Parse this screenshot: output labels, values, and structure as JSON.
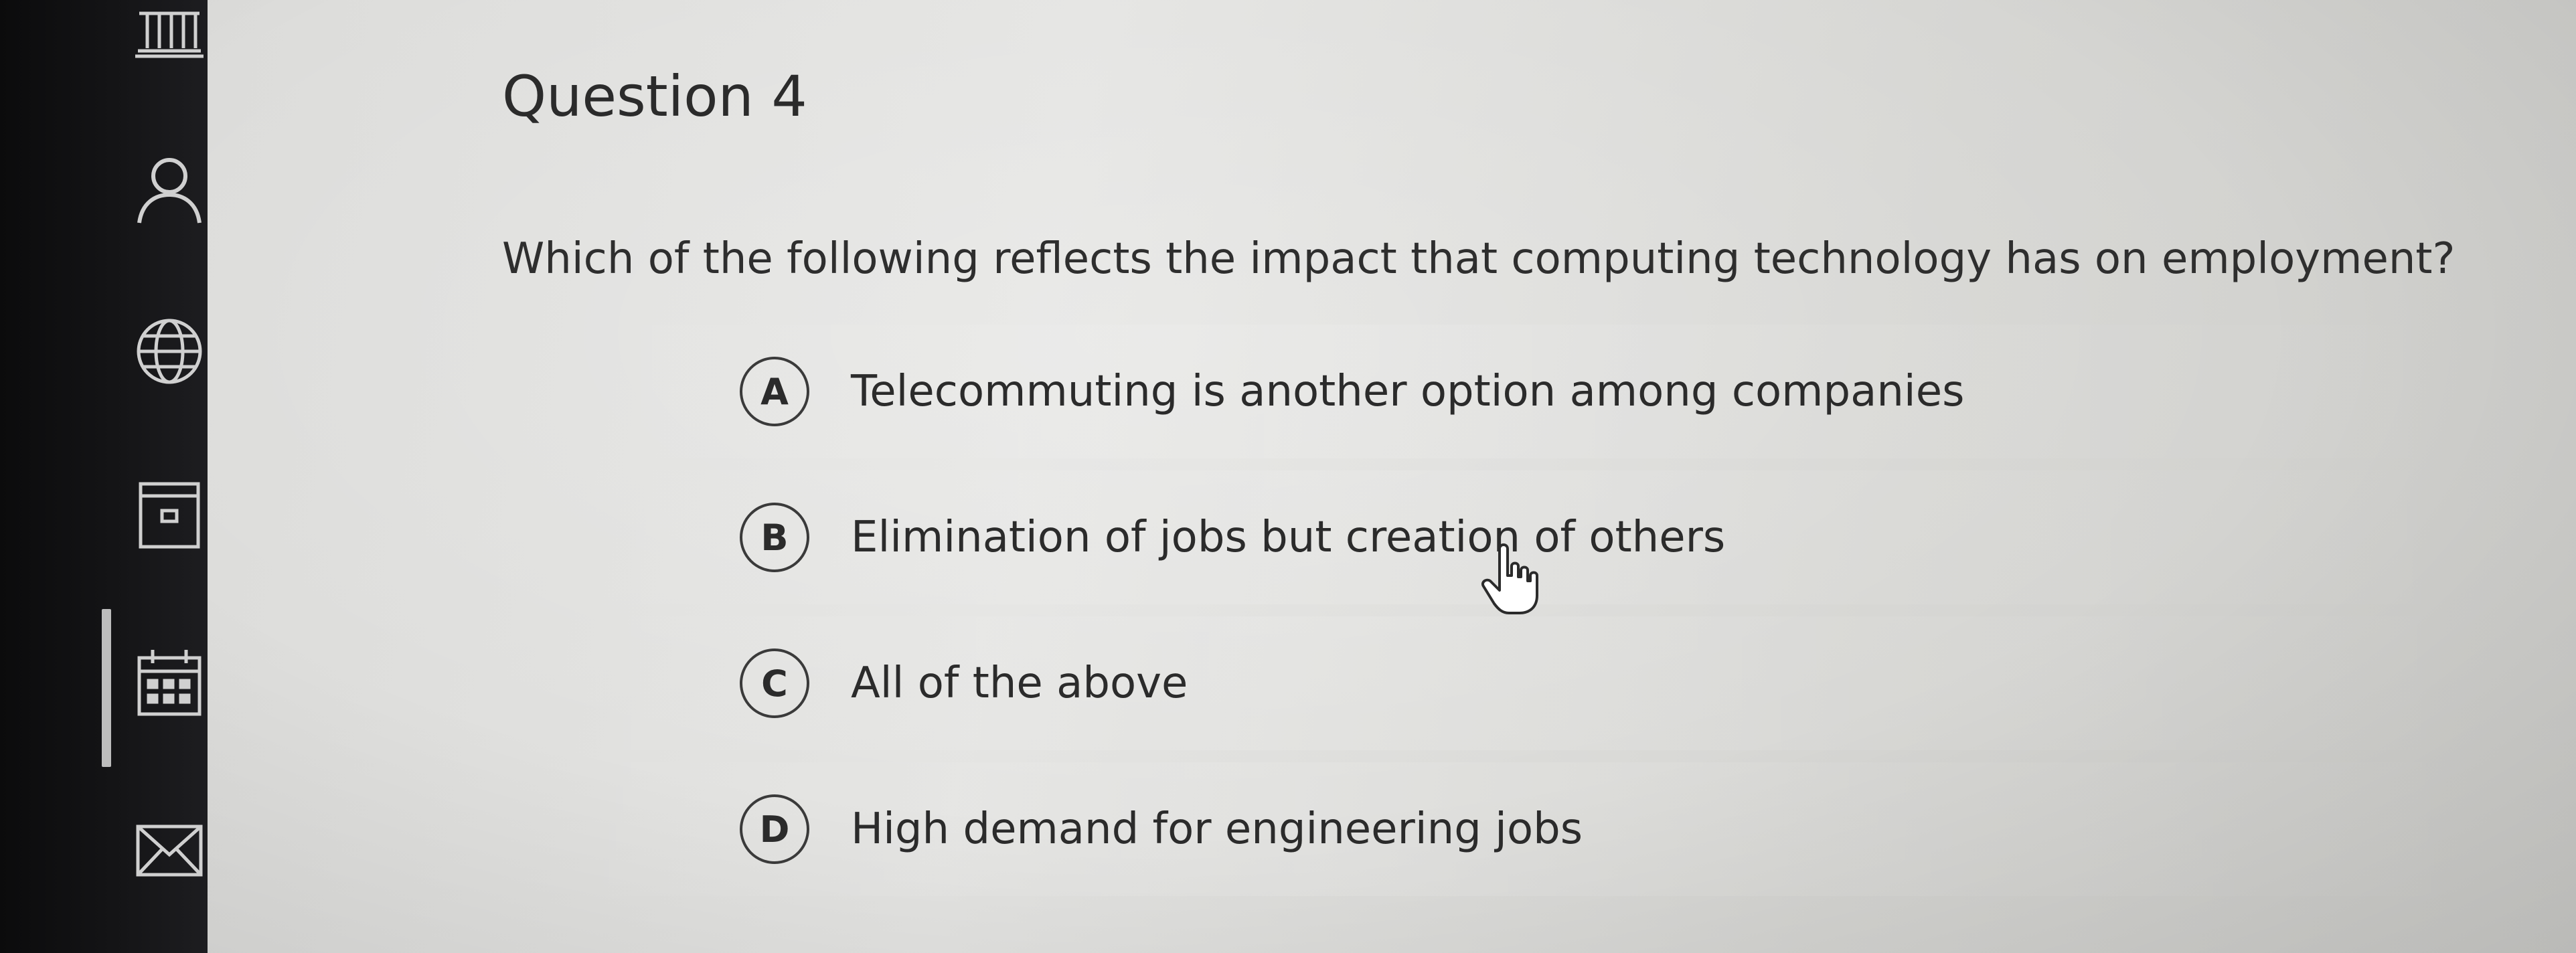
{
  "question": {
    "title": "Question 4",
    "prompt": "Which of the following reflects the impact that computing technology has on employment?"
  },
  "options": [
    {
      "letter": "A",
      "text": "Telecommuting is another option among companies"
    },
    {
      "letter": "B",
      "text": "Elimination of jobs but creation of others"
    },
    {
      "letter": "C",
      "text": "All of the above"
    },
    {
      "letter": "D",
      "text": "High demand for engineering jobs"
    }
  ],
  "sidebar": {
    "icons": [
      "institution-icon",
      "user-icon",
      "globe-icon",
      "document-icon",
      "calendar-icon",
      "mail-icon"
    ],
    "active": "calendar-icon"
  },
  "colors": {
    "sidebar_bg": "#141416",
    "content_bg": "#dcdcda",
    "text": "#2b2b2b"
  }
}
